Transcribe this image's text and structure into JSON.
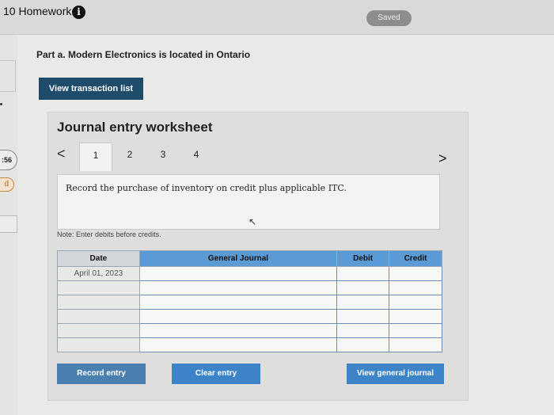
{
  "header": {
    "assignment_title": "10 Homework",
    "info_icon": "i",
    "saved_status": "Saved"
  },
  "left_strip": {
    "timer": ":56",
    "badge": "d"
  },
  "problem": {
    "cut_off_text": "",
    "part_title": "Part a. Modern Electronics is located in Ontario",
    "view_transactions_label": "View transaction list"
  },
  "worksheet": {
    "title": "Journal entry worksheet",
    "prev_icon": "<",
    "next_icon": ">",
    "tabs": [
      "1",
      "2",
      "3",
      "4"
    ],
    "description": "Record the purchase of inventory on credit plus applicable ITC.",
    "note": "Note: Enter debits before credits.",
    "table": {
      "headers": {
        "date": "Date",
        "general_journal": "General Journal",
        "debit": "Debit",
        "credit": "Credit"
      },
      "rows": [
        {
          "date": "April 01, 2023"
        },
        {
          "date": ""
        },
        {
          "date": ""
        },
        {
          "date": ""
        },
        {
          "date": ""
        },
        {
          "date": ""
        }
      ]
    },
    "buttons": {
      "record": "Record entry",
      "clear": "Clear entry",
      "view_general": "View general journal"
    }
  }
}
